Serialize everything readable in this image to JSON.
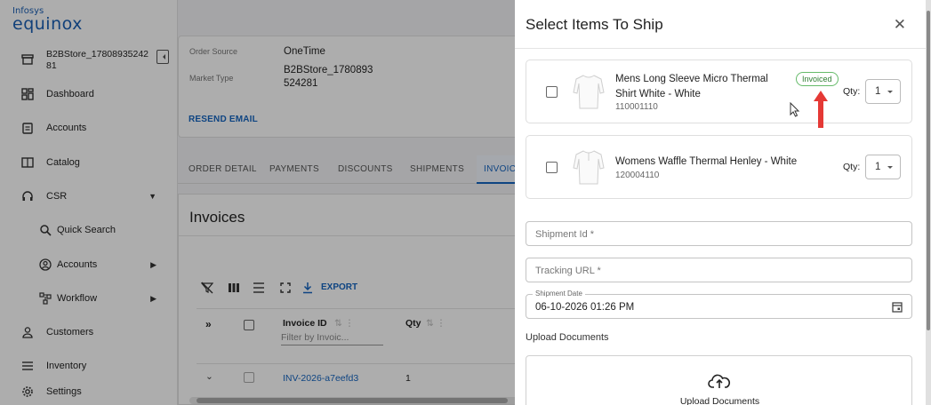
{
  "app": {
    "logo_line1": "Infosys",
    "logo_line2": "equinox"
  },
  "sidebar": {
    "store_name": "B2BStore_1780893524281",
    "items": [
      {
        "label": "Dashboard",
        "icon": "dashboard-icon"
      },
      {
        "label": "Accounts",
        "icon": "clipboard-icon"
      },
      {
        "label": "Catalog",
        "icon": "book-icon"
      },
      {
        "label": "CSR",
        "icon": "headset-icon"
      },
      {
        "label": "Quick Search",
        "icon": "search-icon"
      },
      {
        "label": "Accounts",
        "icon": "account-circle-icon"
      },
      {
        "label": "Workflow",
        "icon": "workflow-icon"
      },
      {
        "label": "Customers",
        "icon": "person-icon"
      },
      {
        "label": "Inventory",
        "icon": "list-icon"
      },
      {
        "label": "Settings",
        "icon": "gear-icon"
      }
    ]
  },
  "order": {
    "source_label": "Order Source",
    "source_value": "OneTime",
    "market_label": "Market Type",
    "market_value": "B2BStore_1780893\n524281",
    "resend_email": "RESEND EMAIL"
  },
  "tabs": [
    "ORDER DETAIL",
    "PAYMENTS",
    "DISCOUNTS",
    "SHIPMENTS",
    "INVOICE"
  ],
  "invoices": {
    "title": "Invoices",
    "export_label": "EXPORT",
    "col_invoice_id": "Invoice ID",
    "col_qty": "Qty",
    "filter_placeholder": "Filter by Invoic...",
    "rows": [
      {
        "id": "INV-2026-a7eefd3",
        "qty": "1"
      }
    ]
  },
  "drawer": {
    "title": "Select Items To Ship",
    "items": [
      {
        "name": "Mens Long Sleeve Micro Thermal Shirt White - White",
        "sku": "110001110",
        "badge": "Invoiced",
        "qty_label": "Qty:",
        "qty": "1"
      },
      {
        "name": "Womens Waffle Thermal Henley - White",
        "sku": "120004110",
        "qty_label": "Qty:",
        "qty": "1"
      }
    ],
    "shipment_id_placeholder": "Shipment Id *",
    "tracking_url_placeholder": "Tracking URL *",
    "shipment_date_label": "Shipment Date",
    "shipment_date_value": "06-10-2026 01:26 PM",
    "upload_section_title": "Upload Documents",
    "upload_button_label": "Upload Documents"
  },
  "colors": {
    "brand_blue": "#1565c0",
    "badge_green": "#2e7d32",
    "arrow_red": "#e53935"
  }
}
